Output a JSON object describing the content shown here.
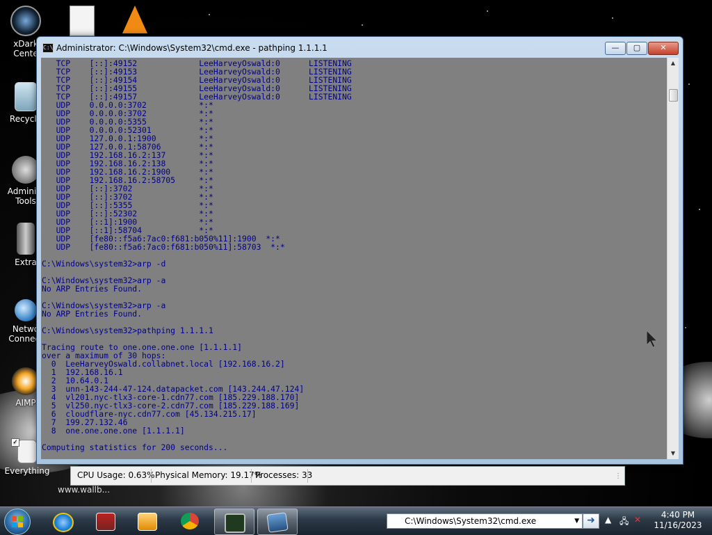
{
  "desktop": {
    "icons": [
      {
        "label_line1": "xDark",
        "label_line2": "Cente"
      },
      {
        "label_line1": "Recycle",
        "label_line2": ""
      },
      {
        "label_line1": "Administ",
        "label_line2": "Tools"
      },
      {
        "label_line1": "Extra",
        "label_line2": ""
      },
      {
        "label_line1": "Netwo",
        "label_line2": "Connect"
      },
      {
        "label_line1": "AIMP",
        "label_line2": ""
      },
      {
        "label_line1": "Everything",
        "label_line2": ""
      }
    ],
    "wallpaper_caption": "www.wallb..."
  },
  "window": {
    "title": "Administrator: C:\\Windows\\System32\\cmd.exe - pathping  1.1.1.1",
    "buttons": {
      "minimize": "—",
      "maximize": "▢",
      "close": "✕"
    },
    "console_text": "   TCP    [::]:49152             LeeHarveyOswald:0      LISTENING\n   TCP    [::]:49153             LeeHarveyOswald:0      LISTENING\n   TCP    [::]:49154             LeeHarveyOswald:0      LISTENING\n   TCP    [::]:49155             LeeHarveyOswald:0      LISTENING\n   TCP    [::]:49157             LeeHarveyOswald:0      LISTENING\n   UDP    0.0.0.0:3702           *:*\n   UDP    0.0.0.0:3702           *:*\n   UDP    0.0.0.0:5355           *:*\n   UDP    0.0.0.0:52301          *:*\n   UDP    127.0.0.1:1900         *:*\n   UDP    127.0.0.1:58706        *:*\n   UDP    192.168.16.2:137       *:*\n   UDP    192.168.16.2:138       *:*\n   UDP    192.168.16.2:1900      *:*\n   UDP    192.168.16.2:58705     *:*\n   UDP    [::]:3702              *:*\n   UDP    [::]:3702              *:*\n   UDP    [::]:5355              *:*\n   UDP    [::]:52302             *:*\n   UDP    [::1]:1900             *:*\n   UDP    [::1]:58704            *:*\n   UDP    [fe80::f5a6:7ac0:f681:b050%11]:1900  *:*\n   UDP    [fe80::f5a6:7ac0:f681:b050%11]:58703  *:*\n\nC:\\Windows\\system32>arp -d\n\nC:\\Windows\\system32>arp -a\nNo ARP Entries Found.\n\nC:\\Windows\\system32>arp -a\nNo ARP Entries Found.\n\nC:\\Windows\\system32>pathping 1.1.1.1\n\nTracing route to one.one.one.one [1.1.1.1]\nover a maximum of 30 hops:\n  0  LeeHarveyOswald.collabnet.local [192.168.16.2]\n  1  192.168.16.1\n  2  10.64.0.1\n  3  unn-143-244-47-124.datapacket.com [143.244.47.124]\n  4  vl201.nyc-tlx3-core-1.cdn77.com [185.229.188.170]\n  5  vl250.nyc-tlx3-core-2.cdn77.com [185.229.188.169]\n  6  cloudflare-nyc.cdn77.com [45.134.215.17]\n  7  199.27.132.46\n  8  one.one.one.one [1.1.1.1]\n\nComputing statistics for 200 seconds...",
    "console_bg": "#808080",
    "console_fg": "#00008b"
  },
  "statusbar": {
    "cpu": "CPU Usage: 0.63%",
    "memory": "Physical Memory: 19.17%",
    "processes": "Processes: 33"
  },
  "taskbar": {
    "address_value": "C:\\Windows\\System32\\cmd.exe",
    "go_label": "➜",
    "time": "4:40 PM",
    "date": "11/16/2023",
    "pinned": [
      "start-orb",
      "internet-explorer-icon",
      "archive-icon",
      "media-player-icon",
      "chrome-icon",
      "task-manager-icon",
      "cmd-window-icon"
    ]
  }
}
